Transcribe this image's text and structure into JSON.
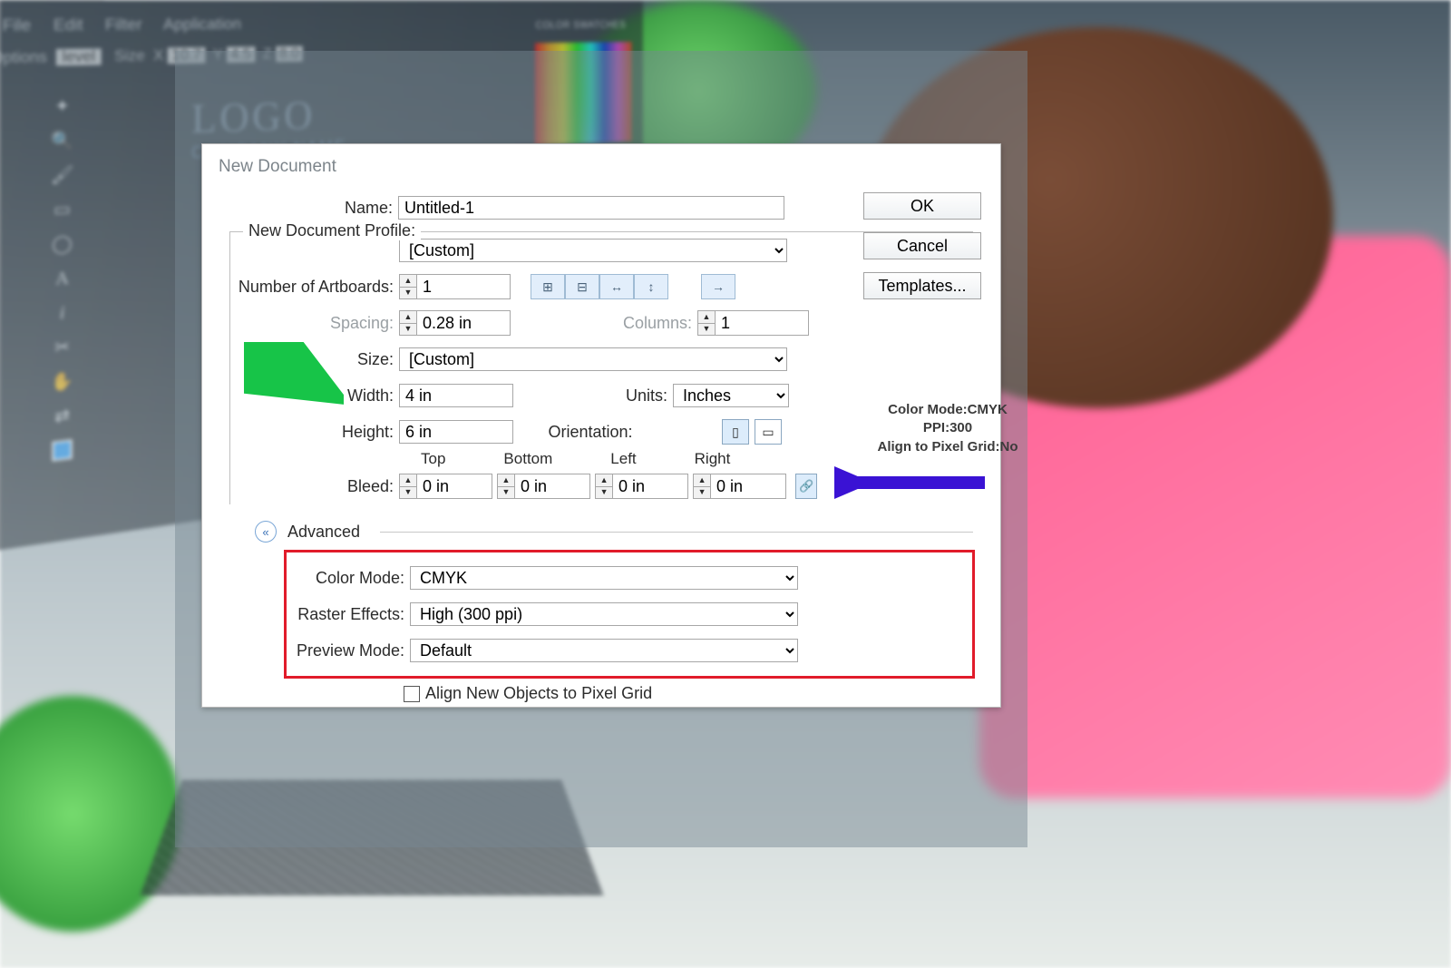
{
  "menubar": {
    "file": "File",
    "edit": "Edit",
    "filter": "Filter",
    "application": "Application"
  },
  "options": {
    "label": "Options",
    "level": "level",
    "size": "Size",
    "x": "X",
    "xv": "10.7",
    "y": "Y",
    "yv": "4.5",
    "z": "Z",
    "zv": "8.0"
  },
  "swatchHdr": "COLOR SWATCHES",
  "logo": {
    "big": "LOGO",
    "company": "COMPANY NAME"
  },
  "dialog": {
    "title": "New Document",
    "name_lbl": "Name:",
    "name": "Untitled-1",
    "profile_lbl": "New Document Profile:",
    "profile": "[Custom]",
    "artboards_lbl": "Number of Artboards:",
    "artboards": "1",
    "spacing_lbl": "Spacing:",
    "spacing": "0.28 in",
    "columns_lbl": "Columns:",
    "columns": "1",
    "size_lbl": "Size:",
    "size": "[Custom]",
    "width_lbl": "Width:",
    "width": "4 in",
    "units_lbl": "Units:",
    "units": "Inches",
    "height_lbl": "Height:",
    "height": "6 in",
    "orient_lbl": "Orientation:",
    "bleed_lbl": "Bleed:",
    "top": "Top",
    "bottom": "Bottom",
    "left": "Left",
    "right": "Right",
    "bleed_top": "0 in",
    "bleed_bottom": "0 in",
    "bleed_left": "0 in",
    "bleed_right": "0 in",
    "advanced": "Advanced",
    "colormode_lbl": "Color Mode:",
    "colormode": "CMYK",
    "raster_lbl": "Raster Effects:",
    "raster": "High (300 ppi)",
    "preview_lbl": "Preview Mode:",
    "preview": "Default",
    "align_lbl": "Align New Objects to Pixel Grid"
  },
  "actions": {
    "ok": "OK",
    "cancel": "Cancel",
    "templates": "Templates..."
  },
  "info": {
    "l1": "Color Mode:CMYK",
    "l2": "PPI:300",
    "l3": "Align to Pixel Grid:No"
  }
}
